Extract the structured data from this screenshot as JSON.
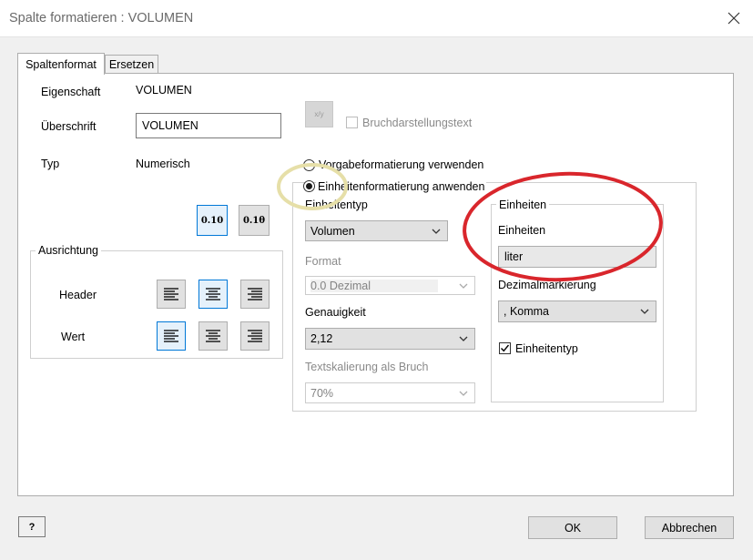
{
  "window": {
    "title": "Spalte formatieren : VOLUMEN"
  },
  "tabs": [
    {
      "label": "Spaltenformat",
      "active": true
    },
    {
      "label": "Ersetzen",
      "active": false
    }
  ],
  "left": {
    "eigenschaft_label": "Eigenschaft",
    "eigenschaft_value": "VOLUMEN",
    "ueberschrift_label": "Überschrift",
    "ueberschrift_value": "VOLUMEN",
    "typ_label": "Typ",
    "typ_value": "Numerisch",
    "format_btn_decimal": "0.10",
    "format_btn_fraction": "0.1θ",
    "ausrichtung": {
      "title": "Ausrichtung",
      "header_label": "Header",
      "wert_label": "Wert"
    }
  },
  "right": {
    "fraction_icon_label": "x/y",
    "bruch_label": "Bruchdarstellungstext",
    "radio_vorgabe": "Vorgabeformatierung verwenden",
    "radio_einheit": "Einheitenformatierung anwenden",
    "einheitentyp_label": "Einheitentyp",
    "einheitentyp_value": "Volumen",
    "format_label": "Format",
    "format_value": "0.0 Dezimal",
    "genauigkeit_label": "Genauigkeit",
    "genauigkeit_value": "2,12",
    "textskalierung_label": "Textskalierung als Bruch",
    "textskalierung_value": "70%",
    "einheiten_group": {
      "title": "Einheiten",
      "einheiten_label": "Einheiten",
      "einheiten_value": "liter",
      "dezimal_label": "Dezimalmarkierung",
      "dezimal_value": ", Komma",
      "einheitentyp_check_label": "Einheitentyp"
    }
  },
  "footer": {
    "help_label": "?",
    "ok_label": "OK",
    "cancel_label": "Abbrechen"
  },
  "colors": {
    "annotation_red": "#d9262c",
    "annotation_yellow": "#e6dfa8",
    "selected_blue": "#0078d7"
  }
}
